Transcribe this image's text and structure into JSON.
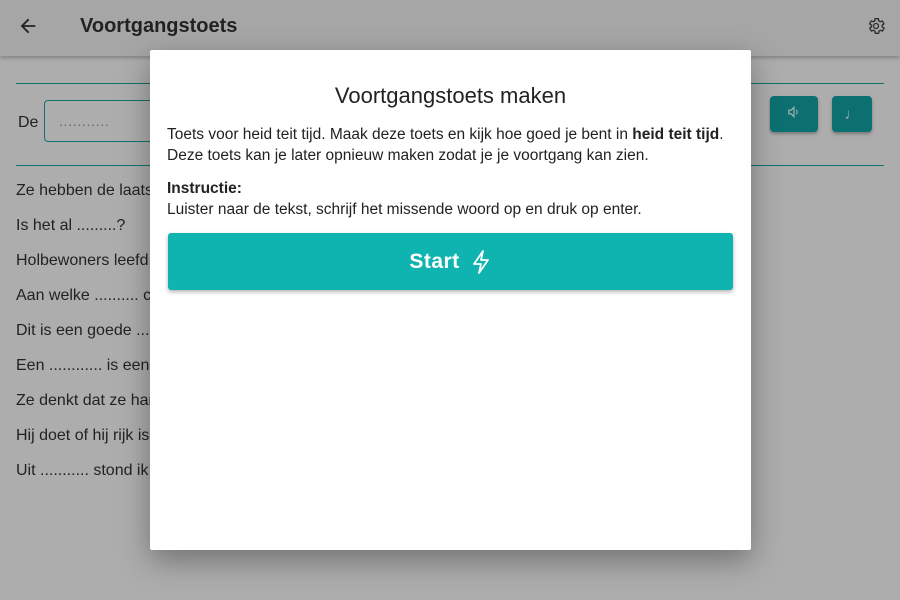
{
  "appbar": {
    "title": "Voortgangstoets",
    "back_icon": "arrow-left-icon",
    "settings_icon": "gear-icon"
  },
  "background": {
    "input_label": "De",
    "input_placeholder": "...........",
    "audio_icon": "speaker-icon",
    "music_icon": "music-note-icon",
    "music_glyph": "♩",
    "sentences": [
      "Ze hebben de laats",
      "Is het al .........?",
      "Holbewoners leefd",
      "Aan welke .......... c",
      "Dit is een goede ...",
      "Een ............ is een",
      "Ze denkt dat ze har",
      "Hij doet of hij rijk is",
      "Uit ........... stond ik"
    ]
  },
  "dialog": {
    "title": "Voortgangstoets maken",
    "body_part1": "Toets voor heid teit tijd. Maak deze toets en kijk hoe goed je bent in ",
    "body_bold": "heid teit tijd",
    "body_part2": ". Deze toets kan je later opnieuw maken zodat je je voortgang kan zien.",
    "instruction_heading": "Instructie:",
    "instruction_text": "Luister naar de tekst, schrijf het missende woord op en druk op enter.",
    "start_label": "Start",
    "start_icon": "lightning-icon"
  },
  "colors": {
    "accent": "#0fb3b0",
    "accent_dark": "#12a6a6",
    "scrim": "rgba(0,0,0,0.32)"
  }
}
